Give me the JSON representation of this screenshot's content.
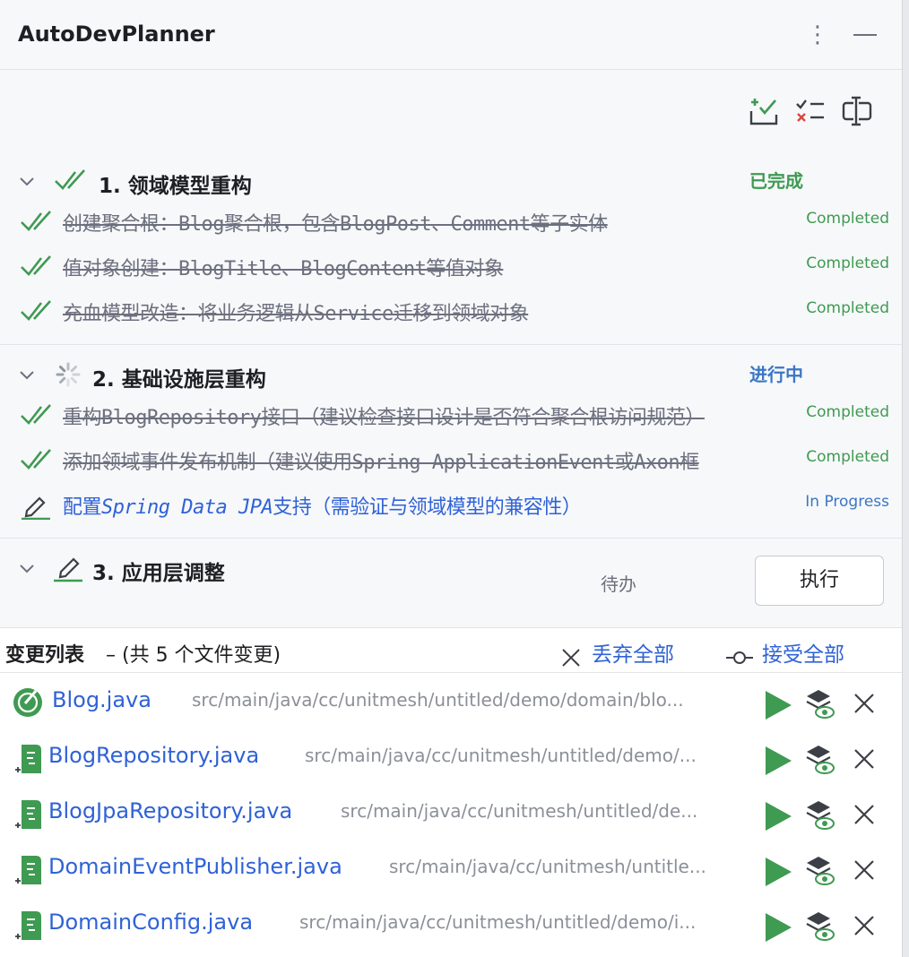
{
  "header": {
    "title": "AutoDevPlanner",
    "more_icon": "more-vertical-icon",
    "minimize_icon": "minimize-icon"
  },
  "toolbar": {
    "icons": [
      "add-task-icon",
      "checklist-icon",
      "edit-plan-icon"
    ]
  },
  "sections": [
    {
      "title": "1. 领域模型重构",
      "status": "已完成",
      "status_color": "#3f9a52",
      "tasks": [
        {
          "text": "创建聚合根：Blog聚合根，包含BlogPost、Comment等子实体",
          "status": "Completed"
        },
        {
          "text": "值对象创建：BlogTitle、BlogContent等值对象",
          "status": "Completed"
        },
        {
          "text": "充血模型改造：将业务逻辑从Service迁移到领域对象",
          "status": "Completed"
        }
      ]
    },
    {
      "title": "2. 基础设施层重构",
      "status": "进行中",
      "status_color": "#3b76c4",
      "tasks": [
        {
          "text": "重构BlogRepository接口（建议检查接口设计是否符合聚合根访问规范）",
          "status": "Completed"
        },
        {
          "text": "添加领域事件发布机制（建议使用Spring ApplicationEvent或Axon框",
          "status": "Completed"
        },
        {
          "text_prefix": "配置",
          "text_italic": "Spring Data JPA",
          "text_suffix": "支持（需验证与领域模型的兼容性）",
          "status": "In Progress"
        }
      ]
    },
    {
      "title": "3. 应用层调整",
      "status": "待办",
      "status_color": "#6c707e",
      "button": "执行"
    }
  ],
  "changes": {
    "title": "变更列表",
    "count_text": "– (共 5 个文件变更)",
    "discard_all": "丢弃全部",
    "accept_all": "接受全部",
    "files": [
      {
        "name": "Blog.java",
        "path": "src/main/java/cc/unitmesh/untitled/demo/domain/blo...",
        "icon": "java-class-modified-icon"
      },
      {
        "name": "BlogRepository.java",
        "path": "src/main/java/cc/unitmesh/untitled/demo/...",
        "icon": "java-file-new-icon"
      },
      {
        "name": "BlogJpaRepository.java",
        "path": "src/main/java/cc/unitmesh/untitled/de...",
        "icon": "java-file-new-icon"
      },
      {
        "name": "DomainEventPublisher.java",
        "path": "src/main/java/cc/unitmesh/untitle...",
        "icon": "java-file-new-icon"
      },
      {
        "name": "DomainConfig.java",
        "path": "src/main/java/cc/unitmesh/untitled/demo/i...",
        "icon": "java-file-new-icon"
      }
    ]
  },
  "colors": {
    "accent": "#2f62d6",
    "success": "#3f9a52",
    "run": "#3f9a52"
  }
}
